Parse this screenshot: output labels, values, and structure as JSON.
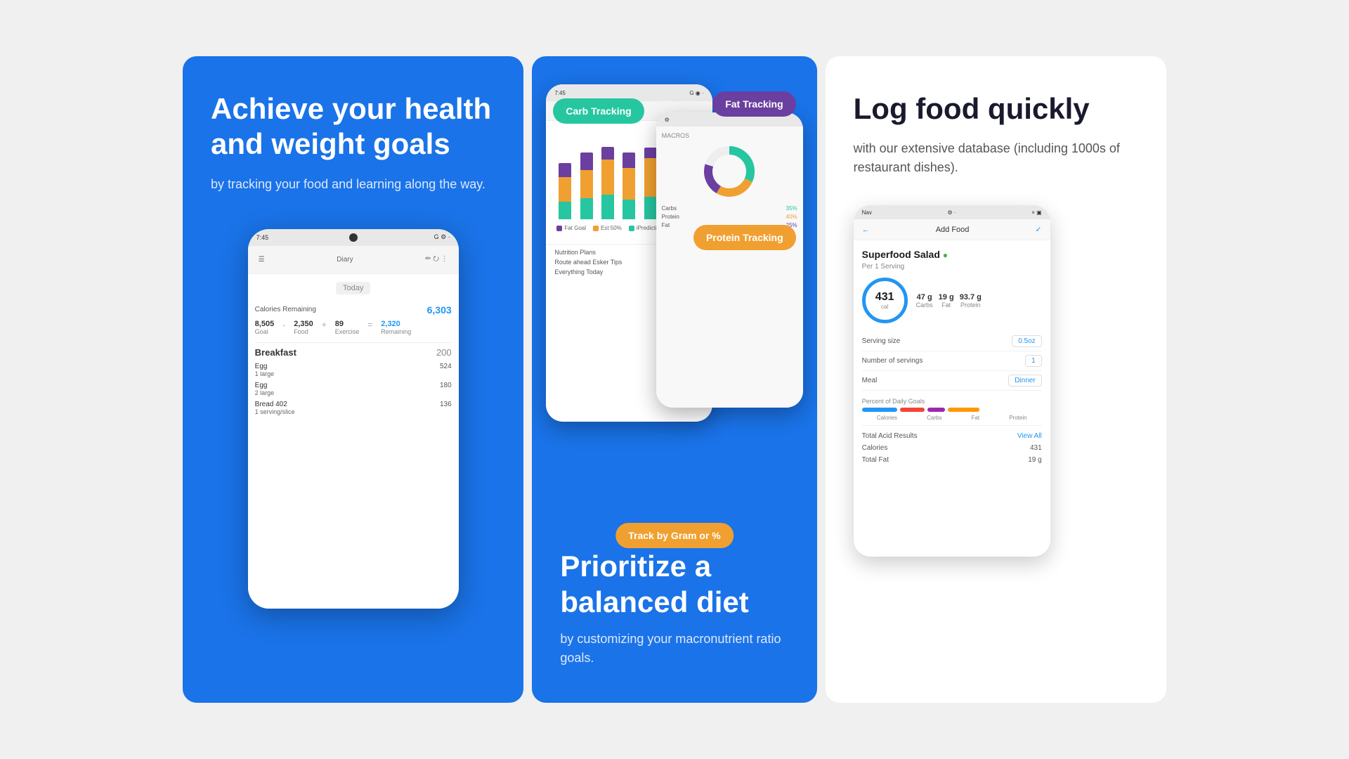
{
  "panel1": {
    "headline": "Achieve your health and weight goals",
    "subtext": "by tracking your food and learning along the way.",
    "phone": {
      "status": "7:45",
      "diary_title": "Diary",
      "date_label": "Today",
      "calories_remaining_label": "Calories Remaining",
      "calories_remaining": "6,303",
      "cal_goal": "8,505",
      "cal_food": "2,350",
      "cal_exercise": "89",
      "remaining_val": "2,320",
      "meal1_title": "Breakfast",
      "meal1_cal": "200",
      "food1_name": "Egg",
      "food1_sub": "1 large",
      "food1_cal": "524",
      "food2_name": "Egg",
      "food2_sub": "2 large",
      "food2_cal": "180",
      "food3_name": "Bread 402",
      "food3_sub": "1 serving/slice",
      "food3_cal": "136"
    }
  },
  "panel2": {
    "badge_carb": "Carb Tracking",
    "badge_fat": "Fat Tracking",
    "badge_protein": "Protein Tracking",
    "badge_track": "Track by Gram or %",
    "headline": "Prioritize a balanced diet",
    "subtext": "by customizing your macronutrient ratio goals.",
    "colors": {
      "carb": "#26c6a0",
      "fat": "#6b3fa0",
      "protein": "#f0a030",
      "track": "#f0a030"
    }
  },
  "panel3": {
    "headline": "Log food quickly",
    "subtext": "with our extensive database (including 1000s of restaurant dishes).",
    "phone": {
      "status": "Nav",
      "header_title": "Add Food",
      "food_name": "Superfood Salad",
      "food_dot": "●",
      "food_sub": "Per 1 Serving",
      "kcal": "431",
      "kcal_label": "cal",
      "macro1_val": "47 g",
      "macro1_label": "Carbs",
      "macro2_val": "19 g",
      "macro2_label": "Fat",
      "macro3_val": "93.7 g",
      "macro3_label": "Protein",
      "serving_size_label": "Serving size",
      "serving_size_val": "0.5oz",
      "servings_label": "Number of servings",
      "servings_val": "1",
      "meal_label": "Meal",
      "meal_val": "Dinner",
      "percent_section": "Percent of Daily Goals",
      "bar1_color": "#2196F3",
      "bar2_color": "#f44336",
      "bar3_color": "#9c27b0",
      "bar4_color": "#ff9800",
      "bar_label1": "Calories",
      "bar_label2": "Carbs",
      "bar_label3": "Fat",
      "bar_label4": "Protein",
      "total_results_label": "Total Acid Results",
      "total_results_val": "View All",
      "calories_label": "Calories",
      "calories_val": "431",
      "total_fat_label": "Total Fat",
      "total_fat_val": "19 g"
    }
  }
}
